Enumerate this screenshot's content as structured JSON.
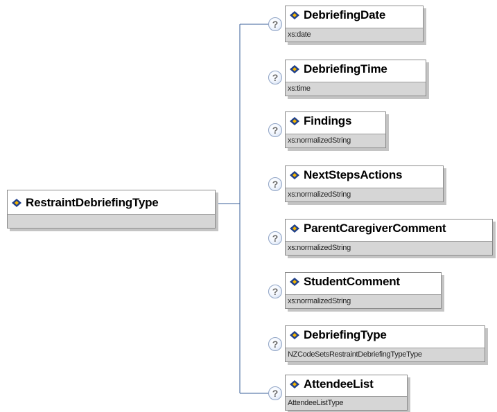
{
  "root": {
    "name": "RestraintDebriefingType"
  },
  "elements": [
    {
      "name": "DebriefingDate",
      "type": "xs:date",
      "help": "?"
    },
    {
      "name": "DebriefingTime",
      "type": "xs:time",
      "help": "?"
    },
    {
      "name": "Findings",
      "type": "xs:normalizedString",
      "help": "?"
    },
    {
      "name": "NextStepsActions",
      "type": "xs:normalizedString",
      "help": "?"
    },
    {
      "name": "ParentCaregiverComment",
      "type": "xs:normalizedString",
      "help": "?"
    },
    {
      "name": "StudentComment",
      "type": "xs:normalizedString",
      "help": "?"
    },
    {
      "name": "DebriefingType",
      "type": "NZCodeSetsRestraintDebriefingTypeType",
      "help": "?"
    },
    {
      "name": "AttendeeList",
      "type": "AttendeeListType",
      "help": "?"
    }
  ],
  "colors": {
    "connector": "#3a5f9a",
    "box_border": "#8a8a8a",
    "type_bar": "#d6d6d6",
    "icon_dark": "#1e3f8a",
    "icon_light": "#f2b400"
  }
}
